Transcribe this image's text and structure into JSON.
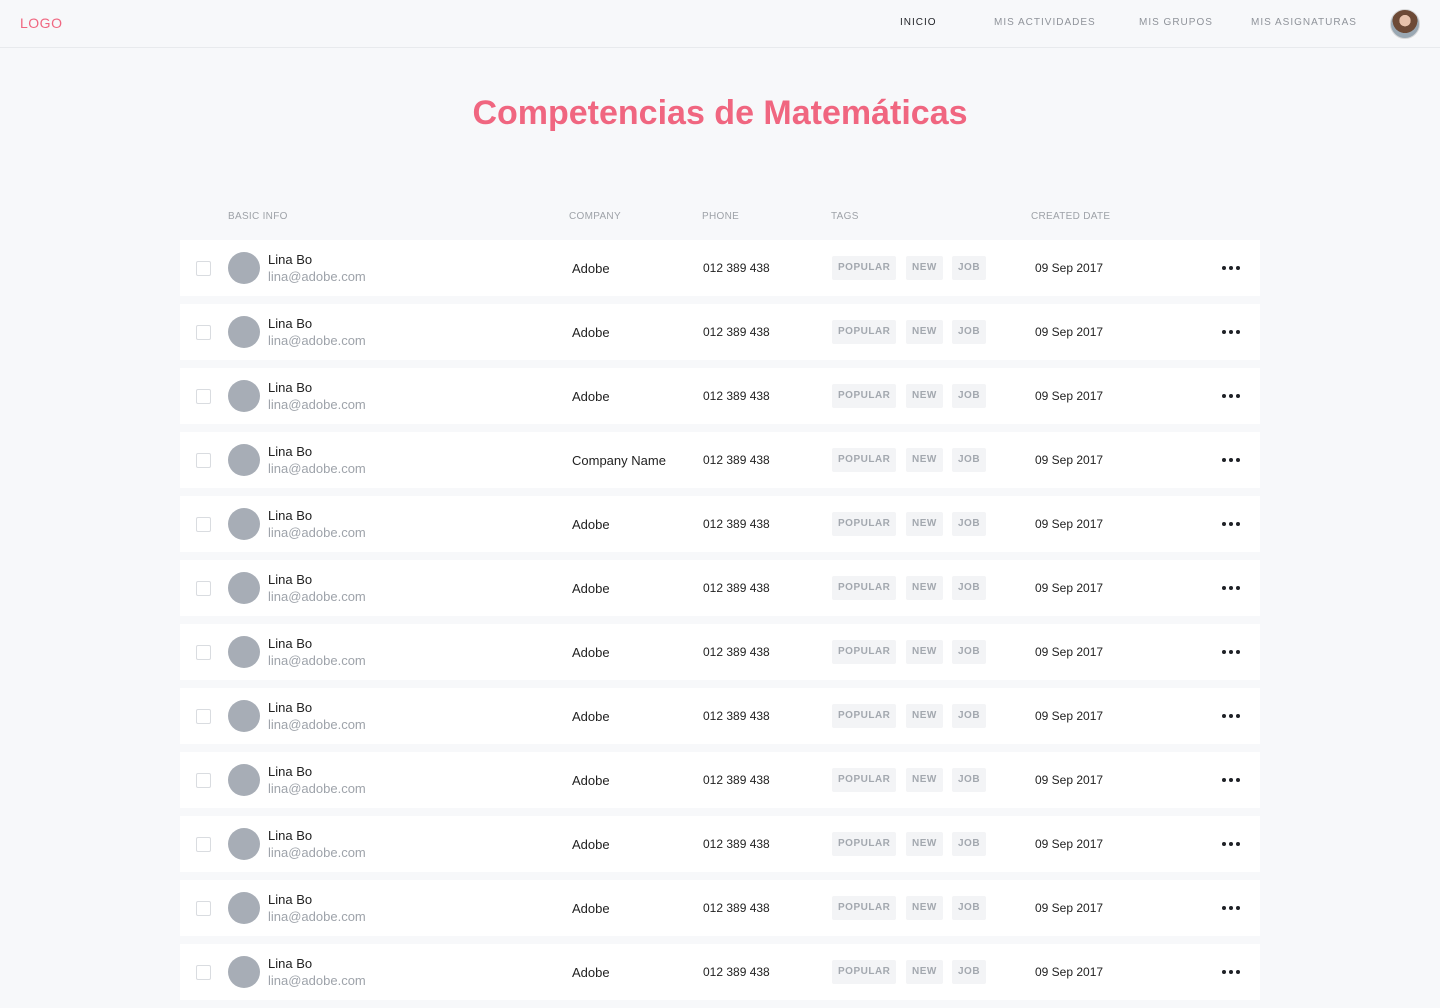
{
  "header": {
    "logo": "LOGO",
    "nav": [
      {
        "label": "INICIO",
        "active": true
      },
      {
        "label": "MIS ACTIVIDADES",
        "active": false
      },
      {
        "label": "MIS GRUPOS",
        "active": false
      },
      {
        "label": "MIS ASIGNATURAS",
        "active": false
      }
    ],
    "avatar_icon": "user-avatar"
  },
  "page": {
    "title": "Competencias de Matemáticas",
    "accent_color": "#f06680"
  },
  "table": {
    "columns": [
      "BASIC INFO",
      "COMPANY",
      "PHONE",
      "TAGS",
      "CREATED DATE"
    ],
    "rows": [
      {
        "name": "Lina Bo",
        "email": "lina@adobe.com",
        "company": "Adobe",
        "phone": "012 389 438",
        "tags": [
          "POPULAR",
          "NEW",
          "JOB"
        ],
        "date": "09 Sep 2017"
      },
      {
        "name": "Lina Bo",
        "email": "lina@adobe.com",
        "company": "Adobe",
        "phone": "012 389 438",
        "tags": [
          "POPULAR",
          "NEW",
          "JOB"
        ],
        "date": "09 Sep 2017"
      },
      {
        "name": "Lina Bo",
        "email": "lina@adobe.com",
        "company": "Adobe",
        "phone": "012 389 438",
        "tags": [
          "POPULAR",
          "NEW",
          "JOB"
        ],
        "date": "09 Sep 2017"
      },
      {
        "name": "Lina Bo",
        "email": "lina@adobe.com",
        "company": "Company Name",
        "phone": "012 389 438",
        "tags": [
          "POPULAR",
          "NEW",
          "JOB"
        ],
        "date": "09 Sep 2017"
      },
      {
        "name": "Lina Bo",
        "email": "lina@adobe.com",
        "company": "Adobe",
        "phone": "012 389 438",
        "tags": [
          "POPULAR",
          "NEW",
          "JOB"
        ],
        "date": "09 Sep 2017"
      },
      {
        "name": "Lina Bo",
        "email": "lina@adobe.com",
        "company": "Adobe",
        "phone": "012 389 438",
        "tags": [
          "POPULAR",
          "NEW",
          "JOB"
        ],
        "date": "09 Sep 2017"
      },
      {
        "name": "Lina Bo",
        "email": "lina@adobe.com",
        "company": "Adobe",
        "phone": "012 389 438",
        "tags": [
          "POPULAR",
          "NEW",
          "JOB"
        ],
        "date": "09 Sep 2017"
      },
      {
        "name": "Lina Bo",
        "email": "lina@adobe.com",
        "company": "Adobe",
        "phone": "012 389 438",
        "tags": [
          "POPULAR",
          "NEW",
          "JOB"
        ],
        "date": "09 Sep 2017"
      },
      {
        "name": "Lina Bo",
        "email": "lina@adobe.com",
        "company": "Adobe",
        "phone": "012 389 438",
        "tags": [
          "POPULAR",
          "NEW",
          "JOB"
        ],
        "date": "09 Sep 2017"
      },
      {
        "name": "Lina Bo",
        "email": "lina@adobe.com",
        "company": "Adobe",
        "phone": "012 389 438",
        "tags": [
          "POPULAR",
          "NEW",
          "JOB"
        ],
        "date": "09 Sep 2017"
      },
      {
        "name": "Lina Bo",
        "email": "lina@adobe.com",
        "company": "Adobe",
        "phone": "012 389 438",
        "tags": [
          "POPULAR",
          "NEW",
          "JOB"
        ],
        "date": "09 Sep 2017"
      },
      {
        "name": "Lina Bo",
        "email": "lina@adobe.com",
        "company": "Adobe",
        "phone": "012 389 438",
        "tags": [
          "POPULAR",
          "NEW",
          "JOB"
        ],
        "date": "09 Sep 2017"
      }
    ]
  }
}
